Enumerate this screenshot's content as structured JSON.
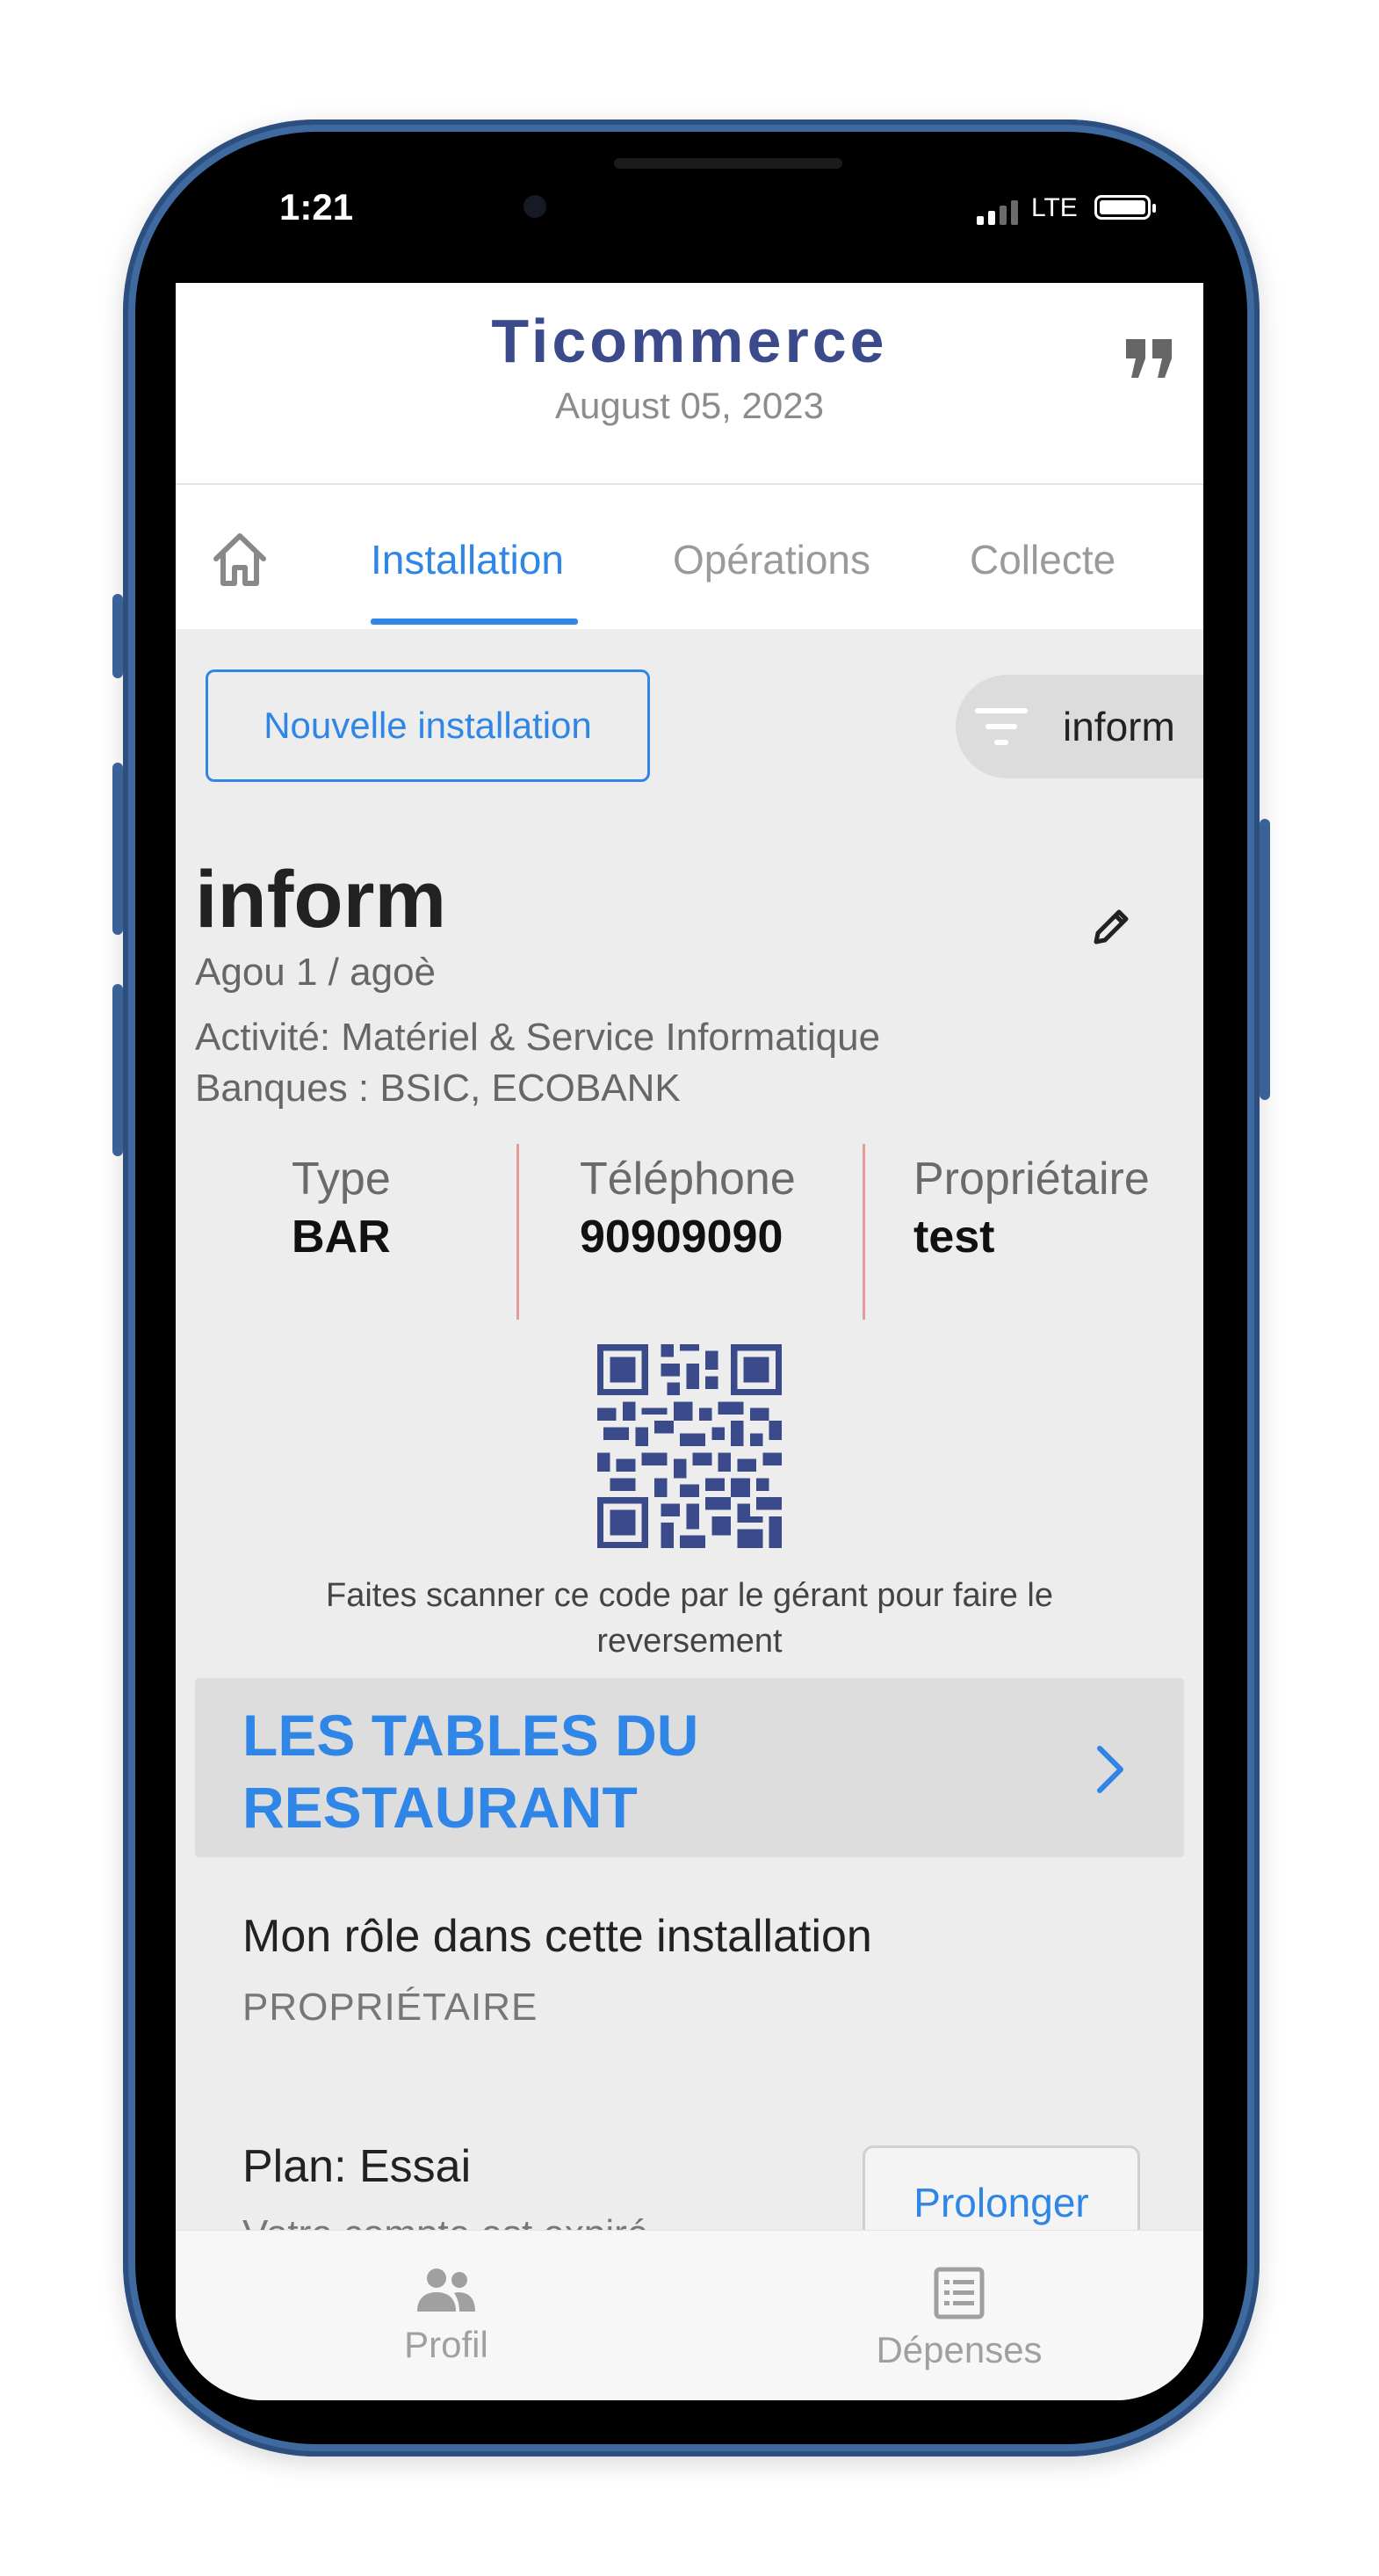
{
  "status_bar": {
    "time": "1:21",
    "network": "LTE"
  },
  "header": {
    "title": "Ticommerce",
    "date": "August 05, 2023"
  },
  "tabs": [
    {
      "label": "Installation",
      "active": true
    },
    {
      "label": "Opérations",
      "active": false
    },
    {
      "label": "Collecte",
      "active": false
    }
  ],
  "actions": {
    "new_installation": "Nouvelle installation",
    "filter_value": "inform"
  },
  "installation": {
    "name": "inform",
    "location": "Agou 1 / agoè",
    "activity": "Activité: Matériel & Service Informatique",
    "banks": "Banques : BSIC, ECOBANK",
    "info": [
      {
        "label": "Type",
        "value": "BAR"
      },
      {
        "label": "Téléphone",
        "value": "90909090"
      },
      {
        "label": "Propriétaire",
        "value": "test"
      }
    ],
    "qr_caption": "Faites scanner ce code par le gérant pour faire le reversement"
  },
  "tables_card": {
    "line1": "LES TABLES DU",
    "line2": "RESTAURANT"
  },
  "role": {
    "title": "Mon rôle dans cette installation",
    "value": "PROPRIÉTAIRE"
  },
  "plan": {
    "title": "Plan: Essai",
    "subtitle": "Votre compte est expiré",
    "extend_button": "Prolonger"
  },
  "bottom_nav": [
    {
      "label": "Profil",
      "icon": "people-icon"
    },
    {
      "label": "Dépenses",
      "icon": "list-icon"
    }
  ],
  "colors": {
    "accent": "#2f86e6",
    "title": "#3b4a8a",
    "frame": "#3f6aa0",
    "divider": "#e89a9a"
  }
}
